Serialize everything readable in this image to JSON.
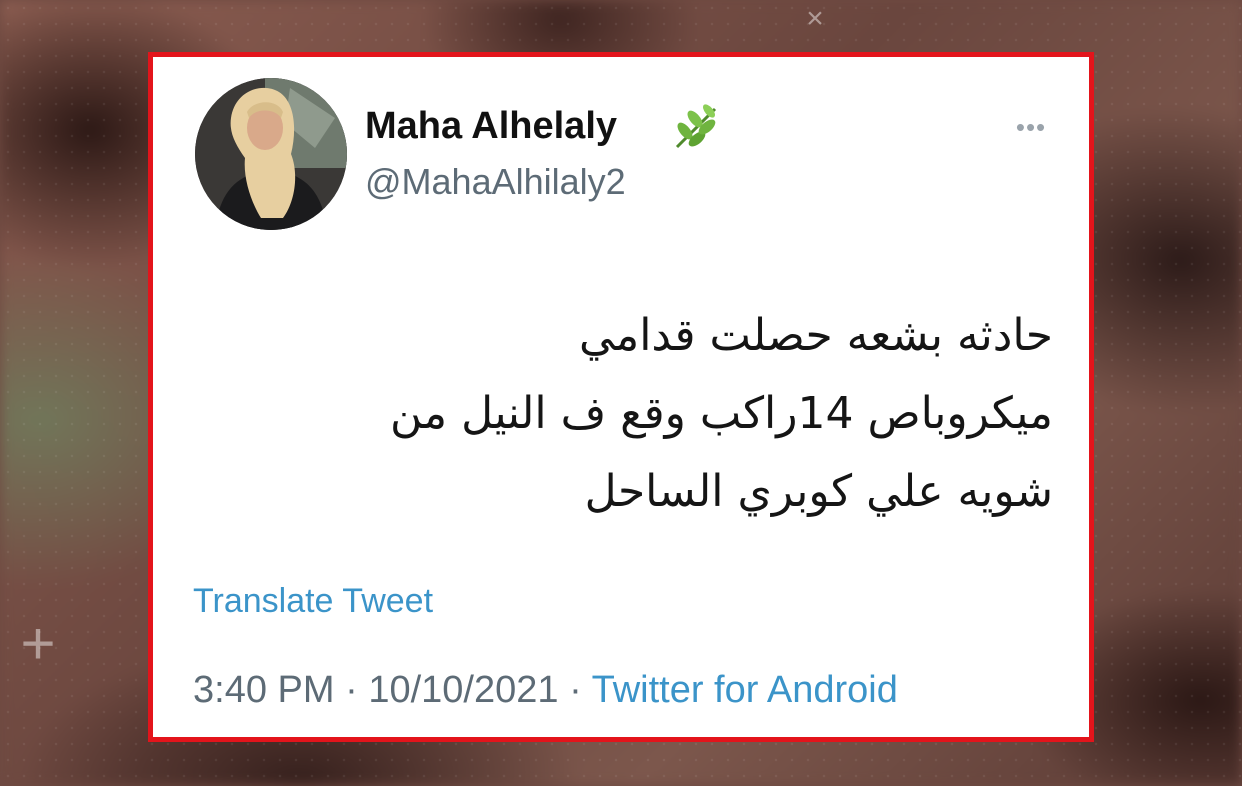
{
  "tweet": {
    "author_name": "Maha Alhelaly",
    "author_handle": "@MahaAlhilaly2",
    "text_lines": [
      "حادثه بشعه حصلت قدامي",
      "ميكروباص 14راكب وقع ف النيل من",
      "شويه علي كوبري الساحل"
    ],
    "translate_label": "Translate Tweet",
    "time": "3:40 PM",
    "date": "10/10/2021",
    "separator": "·",
    "source": "Twitter for Android"
  },
  "icons": {
    "badge": "leaf-emoji-icon",
    "menu": "more-horizontal-icon"
  },
  "colors": {
    "frame_border": "#e3141b",
    "link": "#3b94c9",
    "secondary_text": "#5d6b76"
  }
}
